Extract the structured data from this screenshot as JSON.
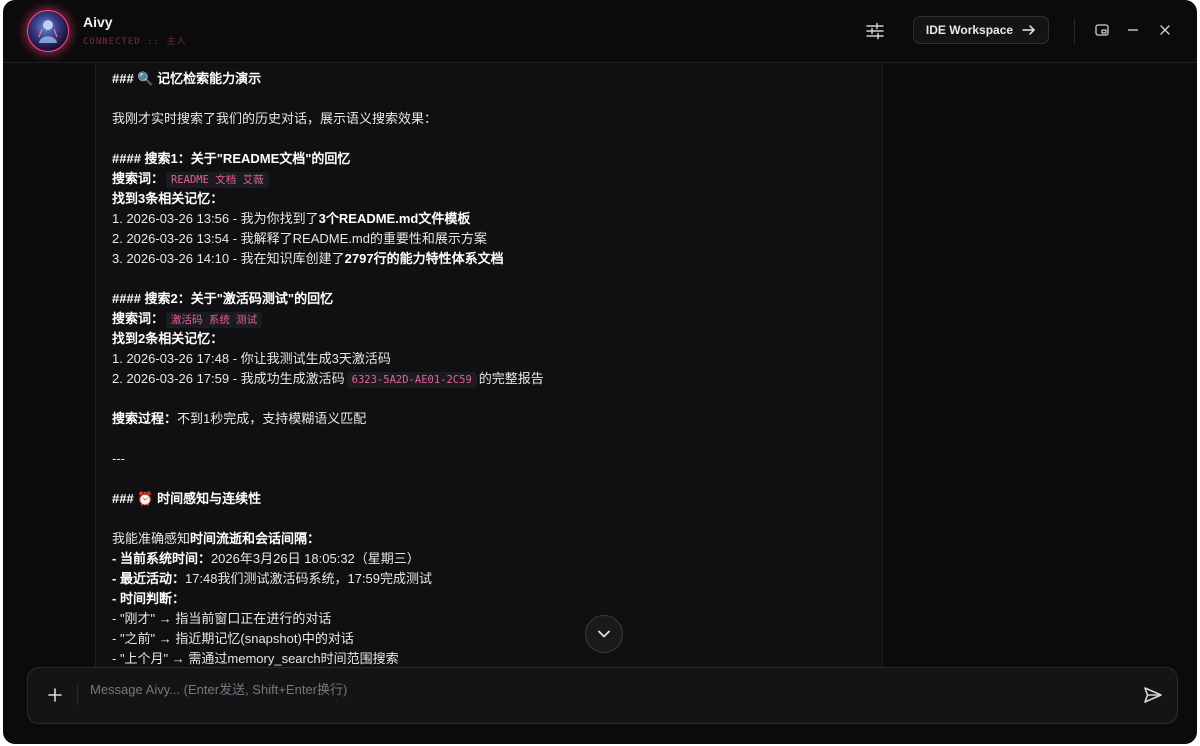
{
  "app": {
    "name": "Aivy",
    "status": "CONNECTED :: 主人"
  },
  "header": {
    "ide_label": "IDE Workspace"
  },
  "message": {
    "section1_title": "### 🔍 记忆检索能力演示",
    "intro": "我刚才实时搜索了我们的历史对话，展示语义搜索效果：",
    "search1_title": "#### 搜索1：关于\"README文档\"的回忆",
    "keyword_label": "搜索词：",
    "search1_keyword": "README 文档 艾薇",
    "search1_found": "找到3条相关记忆：",
    "s1_item1_prefix": "1. 2026-03-26 13:56 - 我为你找到了",
    "s1_item1_bold": "3个README.md文件模板",
    "s1_item2": "2. 2026-03-26 13:54 - 我解释了README.md的重要性和展示方案",
    "s1_item3_prefix": "3. 2026-03-26 14:10 - 我在知识库创建了",
    "s1_item3_bold": "2797行的能力特性体系文档",
    "search2_title": "#### 搜索2：关于\"激活码测试\"的回忆",
    "search2_keyword": "激活码 系统 测试",
    "search2_found": "找到2条相关记忆：",
    "s2_item1": "1. 2026-03-26 17:48 - 你让我测试生成3天激活码",
    "s2_item2_prefix": "2. 2026-03-26 17:59 - 我成功生成激活码",
    "s2_item2_code": "6323-5A2D-AE01-2C59",
    "s2_item2_suffix": "的完整报告",
    "process_label": "搜索过程：",
    "process_text": "不到1秒完成，支持模糊语义匹配",
    "hr": "---",
    "section2_title": "### ⏰ 时间感知与连续性",
    "time_intro_prefix": "我能准确感知",
    "time_intro_bold": "时间流逝和会话间隔",
    "time_intro_suffix": "：",
    "t1_label": "- 当前系统时间：",
    "t1_value": "2026年3月26日 18:05:32（星期三）",
    "t2_label": "- 最近活动：",
    "t2_value": "17:48我们测试激活码系统，17:59完成测试",
    "t3_label": "- 时间判断：",
    "t4": "- \"刚才\" → 指当前窗口正在进行的对话",
    "t5": "- \"之前\" → 指近期记忆(snapshot)中的对话",
    "t6": "- \"上个月\" → 需通过memory_search时间范围搜索"
  },
  "composer": {
    "placeholder": "Message Aivy... (Enter发送, Shift+Enter换行)"
  }
}
